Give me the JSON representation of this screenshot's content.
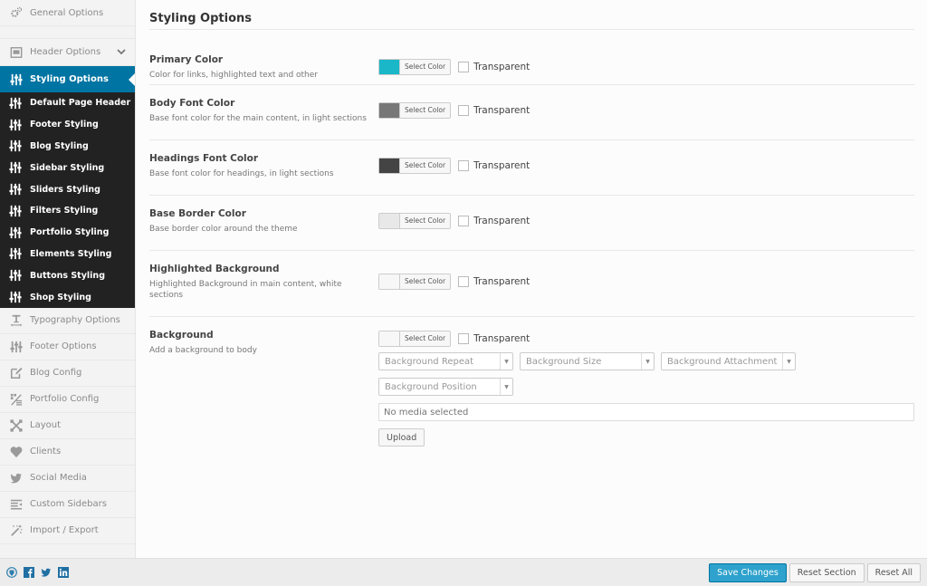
{
  "sidebar": {
    "items_top": [
      {
        "label": "General Options",
        "icon": "gears-icon"
      }
    ],
    "header_options": {
      "label": "Header Options",
      "icon": "header-icon"
    },
    "active": {
      "label": "Styling Options",
      "icon": "sliders-icon"
    },
    "submenu": [
      {
        "label": "Default Page Header"
      },
      {
        "label": "Footer Styling"
      },
      {
        "label": "Blog Styling"
      },
      {
        "label": "Sidebar Styling"
      },
      {
        "label": "Sliders Styling"
      },
      {
        "label": "Filters Styling"
      },
      {
        "label": "Portfolio Styling"
      },
      {
        "label": "Elements Styling"
      },
      {
        "label": "Buttons Styling"
      },
      {
        "label": "Shop Styling"
      }
    ],
    "items_bottom": [
      {
        "label": "Typography Options",
        "icon": "typography-icon"
      },
      {
        "label": "Footer Options",
        "icon": "sliders-icon"
      },
      {
        "label": "Blog Config",
        "icon": "edit-icon"
      },
      {
        "label": "Portfolio Config",
        "icon": "portfolio-icon"
      },
      {
        "label": "Layout",
        "icon": "expand-icon"
      },
      {
        "label": "Clients",
        "icon": "heart-icon"
      },
      {
        "label": "Social Media",
        "icon": "twitter-icon"
      },
      {
        "label": "Custom Sidebars",
        "icon": "sidebars-icon"
      },
      {
        "label": "Import / Export",
        "icon": "magic-wand-icon"
      }
    ]
  },
  "main": {
    "title": "Styling Options",
    "select_color_label": "Select Color",
    "transparent_label": "Transparent",
    "fields": [
      {
        "title": "Primary Color",
        "desc": "Color for links, highlighted text and other",
        "color": "#1ab7c8",
        "transparent": false
      },
      {
        "title": "Body Font Color",
        "desc": "Base font color for the main content, in light sections",
        "color": "#777777",
        "transparent": false
      },
      {
        "title": "Headings Font Color",
        "desc": "Base font color for headings, in light sections",
        "color": "#444444",
        "transparent": false
      },
      {
        "title": "Base Border Color",
        "desc": "Base border color around the theme",
        "color": "#e8e8e8",
        "transparent": false
      },
      {
        "title": "Highlighted Background",
        "desc": "Highlighted Background in main content, white sections",
        "color": "#f7f7f7",
        "transparent": false
      },
      {
        "title": "Background",
        "desc": "Add a background to body",
        "color": "#f7f7f7",
        "transparent": false
      }
    ],
    "background": {
      "selects": [
        {
          "placeholder": "Background Repeat"
        },
        {
          "placeholder": "Background Size"
        },
        {
          "placeholder": "Background Attachment"
        },
        {
          "placeholder": "Background Position"
        }
      ],
      "media_placeholder": "No media selected",
      "upload_label": "Upload"
    }
  },
  "footer": {
    "social": [
      "redux-icon",
      "facebook-icon",
      "twitter-icon",
      "linkedin-icon"
    ],
    "save_label": "Save Changes",
    "reset_section_label": "Reset Section",
    "reset_all_label": "Reset All"
  },
  "colors": {
    "accent": "#0074a2",
    "save_button": "#2ea2cc",
    "submenu_bg": "#222222"
  }
}
